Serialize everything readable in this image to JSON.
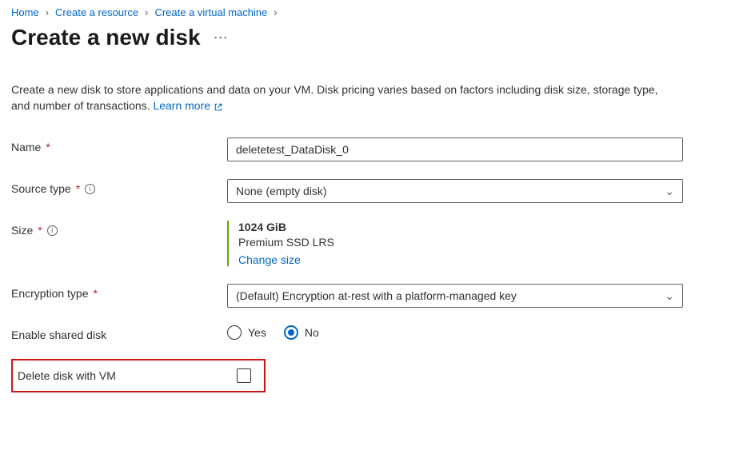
{
  "breadcrumb": {
    "items": [
      {
        "label": "Home"
      },
      {
        "label": "Create a resource"
      },
      {
        "label": "Create a virtual machine"
      }
    ]
  },
  "page": {
    "title": "Create a new disk",
    "description": "Create a new disk to store applications and data on your VM. Disk pricing varies based on factors including disk size, storage type, and number of transactions. ",
    "learn_more": "Learn more"
  },
  "form": {
    "name_label": "Name",
    "name_value": "deletetest_DataDisk_0",
    "source_type_label": "Source type",
    "source_type_value": "None (empty disk)",
    "size_label": "Size",
    "size_value": "1024 GiB",
    "size_tier": "Premium SSD LRS",
    "size_change": "Change size",
    "encryption_label": "Encryption type",
    "encryption_value": "(Default) Encryption at-rest with a platform-managed key",
    "shared_label": "Enable shared disk",
    "shared_yes": "Yes",
    "shared_no": "No",
    "delete_label": "Delete disk with VM"
  }
}
